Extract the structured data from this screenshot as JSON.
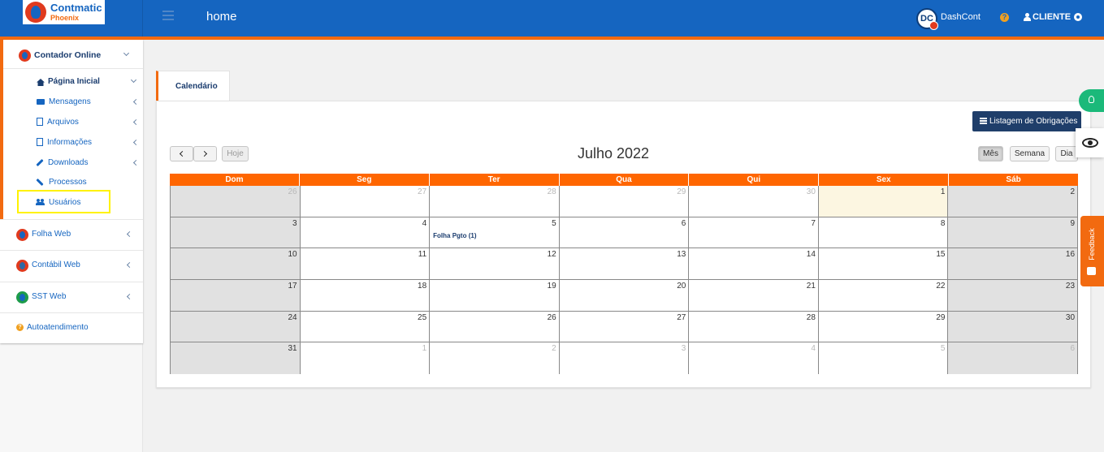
{
  "header": {
    "logo_title": "Contmatic",
    "logo_sub": "Phoenix",
    "page_title": "home",
    "avatar_initials": "DC",
    "account_name": "DashCont",
    "help_glyph": "?",
    "user_label": "CLIENTE"
  },
  "sidebar": {
    "app_main": "Contador Online",
    "items": [
      {
        "label": "Página Inicial",
        "icon": "home-icon"
      },
      {
        "label": "Mensagens",
        "icon": "envelope-icon"
      },
      {
        "label": "Arquivos",
        "icon": "file-icon"
      },
      {
        "label": "Informações",
        "icon": "info-file-icon"
      },
      {
        "label": "Downloads",
        "icon": "wrench-icon"
      },
      {
        "label": "Processos",
        "icon": "hammer-icon"
      },
      {
        "label": "Usuários",
        "icon": "users-icon"
      }
    ],
    "apps": [
      {
        "label": "Folha Web"
      },
      {
        "label": "Contábil Web"
      },
      {
        "label": "SST Web"
      }
    ],
    "support": "Autoatendimento"
  },
  "main": {
    "tab_label": "Calendário",
    "list_button": "Listagem de Obrigações",
    "today_button": "Hoje",
    "month_title": "Julho 2022",
    "views": [
      "Mês",
      "Semana",
      "Dia"
    ],
    "weekdays": [
      "Dom",
      "Seg",
      "Ter",
      "Qua",
      "Qui",
      "Sex",
      "Sáb"
    ],
    "weeks": [
      [
        "26",
        "27",
        "28",
        "29",
        "30",
        "1",
        "2"
      ],
      [
        "3",
        "4",
        "5",
        "6",
        "7",
        "8",
        "9"
      ],
      [
        "10",
        "11",
        "12",
        "13",
        "14",
        "15",
        "16"
      ],
      [
        "17",
        "18",
        "19",
        "20",
        "21",
        "22",
        "23"
      ],
      [
        "24",
        "25",
        "26",
        "27",
        "28",
        "29",
        "30"
      ],
      [
        "31",
        "1",
        "2",
        "3",
        "4",
        "5",
        "6"
      ]
    ],
    "event_label": "Folha Pgto (1)"
  },
  "widgets": {
    "feedback_label": "Feedback"
  },
  "colors": {
    "primary": "#1565c0",
    "accent": "#f26a10",
    "weekend": "#e1e1e1",
    "today": "#fcf6e1",
    "header_row": "#ff6600"
  }
}
